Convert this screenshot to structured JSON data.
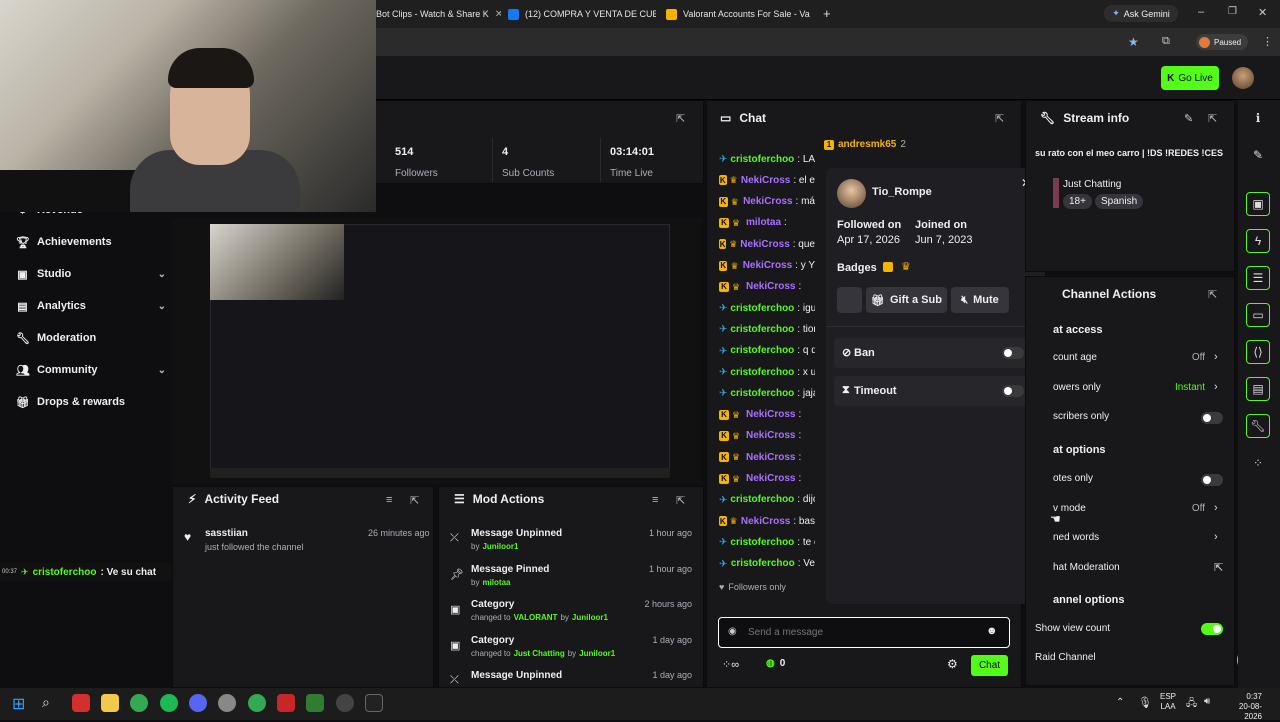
{
  "browser": {
    "tabs": [
      {
        "label": "Bot Clips - Watch & Share K",
        "color": "#2a2a2a"
      },
      {
        "label": "(12) COMPRA Y VENTA DE CUE",
        "color": "#1877f2"
      },
      {
        "label": "Valorant Accounts For Sale - Va",
        "color": "#f5b400"
      }
    ],
    "ask_gemini": "Ask Gemini",
    "profile_status": "Paused"
  },
  "header": {
    "go_live": "Go Live"
  },
  "sidebar": {
    "items": [
      {
        "label": "Revenue",
        "icon": "revenue-icon"
      },
      {
        "label": "Achievements",
        "icon": "trophy-icon"
      },
      {
        "label": "Studio",
        "icon": "studio-icon"
      },
      {
        "label": "Analytics",
        "icon": "analytics-icon"
      },
      {
        "label": "Moderation",
        "icon": "wrench-icon"
      },
      {
        "label": "Community",
        "icon": "community-icon"
      },
      {
        "label": "Drops & rewards",
        "icon": "gift-icon"
      }
    ]
  },
  "stats": [
    {
      "value": "514",
      "label": "Followers"
    },
    {
      "value": "4",
      "label": "Sub Counts"
    },
    {
      "value": "03:14:01",
      "label": "Time Live"
    }
  ],
  "overlay_chat": {
    "time": "00:37",
    "user": "cristoferchoo",
    "text": ": Ve su chat"
  },
  "activity_feed": {
    "title": "Activity Feed",
    "items": [
      {
        "user": "sasstiian",
        "action": "just followed the channel",
        "time": "26 minutes ago"
      }
    ]
  },
  "mod_actions": {
    "title": "Mod Actions",
    "items": [
      {
        "title": "Message Unpinned",
        "pre": "by",
        "mid": "",
        "post": "",
        "user": "Juniloor1",
        "value": "",
        "time": "1 hour ago",
        "icon": "unpin-icon"
      },
      {
        "title": "Message Pinned",
        "pre": "by",
        "mid": "",
        "post": "",
        "user": "milotaa",
        "value": "",
        "time": "1 hour ago",
        "icon": "pin-icon"
      },
      {
        "title": "Category",
        "pre": "changed to",
        "value": "VALORANT",
        "mid": "by",
        "user": "Juniloor1",
        "time": "2 hours ago",
        "icon": "category-icon"
      },
      {
        "title": "Category",
        "pre": "changed to",
        "value": "Just Chatting",
        "mid": "by",
        "user": "Juniloor1",
        "time": "1 day ago",
        "icon": "category-icon"
      },
      {
        "title": "Message Unpinned",
        "pre": "",
        "mid": "",
        "user": "",
        "value": "",
        "time": "1 day ago",
        "icon": "unpin-icon"
      }
    ]
  },
  "chat": {
    "title": "Chat",
    "pinned_user": "andresmk65",
    "pinned_count": "2",
    "lines": [
      {
        "user": "cristoferchoo",
        "text": ": LA",
        "color": "#53fc18",
        "badges": "s"
      },
      {
        "user": "NekiCross",
        "text": ": el e",
        "color": "#a970ff",
        "badges": "kc"
      },
      {
        "user": "NekiCross",
        "text": ": má",
        "color": "#a970ff",
        "badges": "kc"
      },
      {
        "user": "milotaa",
        "text": ":",
        "color": "#a970ff",
        "badges": "kc"
      },
      {
        "user": "NekiCross",
        "text": ": que",
        "color": "#a970ff",
        "badges": "kc"
      },
      {
        "user": "NekiCross",
        "text": ": y Y",
        "color": "#a970ff",
        "badges": "kc"
      },
      {
        "user": "NekiCross",
        "text": ":",
        "color": "#a970ff",
        "badges": "kc"
      },
      {
        "user": "cristoferchoo",
        "text": ": igu",
        "color": "#53fc18",
        "badges": "s"
      },
      {
        "user": "cristoferchoo",
        "text": ": tior",
        "color": "#53fc18",
        "badges": "s"
      },
      {
        "user": "cristoferchoo",
        "text": ": q d",
        "color": "#53fc18",
        "badges": "s"
      },
      {
        "user": "cristoferchoo",
        "text": ": x ur",
        "color": "#53fc18",
        "badges": "s"
      },
      {
        "user": "cristoferchoo",
        "text": ": jaja",
        "color": "#53fc18",
        "badges": "s"
      },
      {
        "user": "NekiCross",
        "text": ":",
        "color": "#a970ff",
        "badges": "kc"
      },
      {
        "user": "NekiCross",
        "text": ":",
        "color": "#a970ff",
        "badges": "kc"
      },
      {
        "user": "NekiCross",
        "text": ":",
        "color": "#a970ff",
        "badges": "kc"
      },
      {
        "user": "NekiCross",
        "text": ":",
        "color": "#a970ff",
        "badges": "kc"
      },
      {
        "user": "cristoferchoo",
        "text": ": dijo",
        "color": "#53fc18",
        "badges": "s"
      },
      {
        "user": "NekiCross",
        "text": ": bas",
        "color": "#a970ff",
        "badges": "kc"
      },
      {
        "user": "cristoferchoo",
        "text": ": te c",
        "color": "#53fc18",
        "badges": "s"
      },
      {
        "user": "cristoferchoo",
        "text": ": Ve",
        "color": "#53fc18",
        "badges": "s"
      }
    ],
    "mode_label": "Followers only",
    "input_placeholder": "Send a message",
    "count": "0",
    "send_label": "Chat"
  },
  "user_card": {
    "username": "Tio_Rompe",
    "followed_label": "Followed on",
    "followed_date": "Apr 17, 2026",
    "joined_label": "Joined on",
    "joined_date": "Jun 7, 2023",
    "badges_label": "Badges",
    "gift_label": "Gift a Sub",
    "mute_label": "Mute",
    "ban_label": "Ban",
    "timeout_label": "Timeout"
  },
  "stream_info": {
    "title": "Stream info",
    "stream_title": "su rato con el meo carro | !DS !REDES !CES",
    "category": "Just Chatting",
    "tags": [
      "18+",
      "Spanish"
    ]
  },
  "channel_actions": {
    "title": "Channel Actions",
    "chat_access_heading": "at access",
    "rows_access": [
      {
        "label": "count age",
        "value": "Off",
        "kind": "chev"
      },
      {
        "label": "owers only",
        "value": "Instant",
        "kind": "chev-green"
      },
      {
        "label": "scribers only",
        "value": "",
        "kind": "toggle"
      }
    ],
    "chat_options_heading": "at options",
    "rows_options": [
      {
        "label": "otes only",
        "value": "",
        "kind": "toggle"
      },
      {
        "label": "v mode",
        "value": "Off",
        "kind": "chev"
      },
      {
        "label": "ned words",
        "value": "",
        "kind": "chev"
      },
      {
        "label": "hat Moderation",
        "value": "",
        "kind": "ext"
      }
    ],
    "channel_options_heading": "annel options",
    "show_view_count": "Show view count",
    "raid_channel": "Raid Channel"
  },
  "tray": {
    "lang": "ESP",
    "sub": "LAA",
    "time": "0:37",
    "date": "20-08-2026"
  }
}
